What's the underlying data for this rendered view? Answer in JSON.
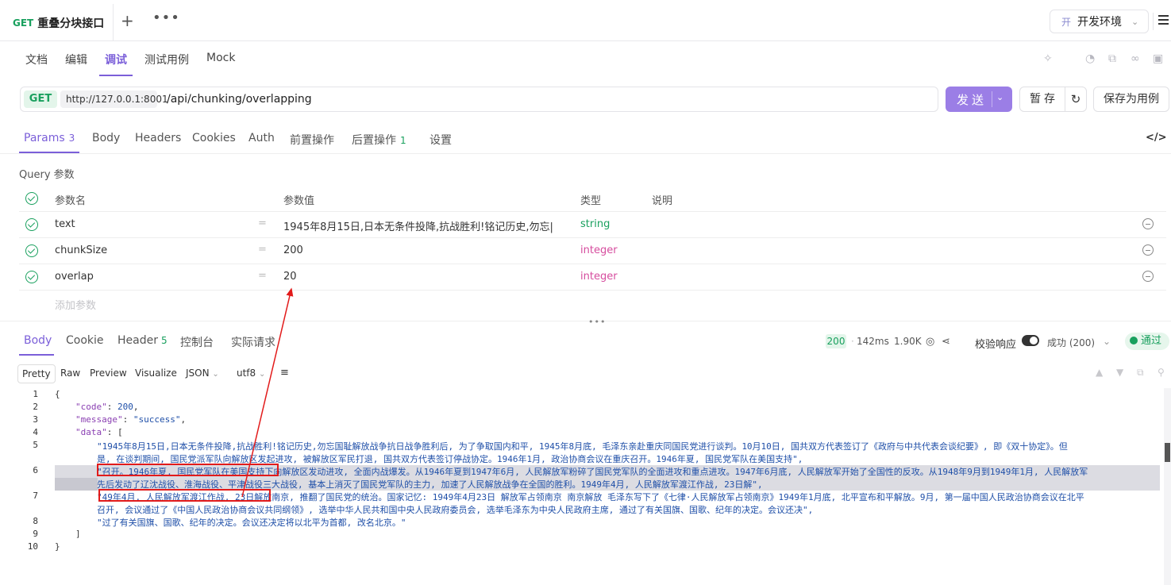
{
  "top_tab": {
    "method": "GET",
    "title": "重叠分块接口",
    "plus": "+",
    "more": "•••"
  },
  "env": {
    "badge": "开",
    "name": "开发环境"
  },
  "sub_tabs": [
    "文档",
    "编辑",
    "调试",
    "测试用例",
    "Mock"
  ],
  "url": {
    "method": "GET",
    "host": "http://127.0.0.1:8001",
    "path": "/api/chunking/overlapping"
  },
  "actions": {
    "send": "发送",
    "save": "暂存",
    "save_as": "保存为用例"
  },
  "req_tabs": [
    {
      "label": "Params",
      "count": "3"
    },
    {
      "label": "Body",
      "count": ""
    },
    {
      "label": "Headers",
      "count": ""
    },
    {
      "label": "Cookies",
      "count": ""
    },
    {
      "label": "Auth",
      "count": ""
    },
    {
      "label": "前置操作",
      "count": ""
    },
    {
      "label": "后置操作",
      "count": "1"
    },
    {
      "label": "设置",
      "count": ""
    }
  ],
  "query": {
    "title": "Query 参数",
    "headers": {
      "name": "参数名",
      "value": "参数值",
      "type": "类型",
      "desc": "说明"
    },
    "rows": [
      {
        "name": "text",
        "value": "1945年8月15日,日本无条件投降,抗战胜利!铭记历史,勿忘|",
        "type": "string"
      },
      {
        "name": "chunkSize",
        "value": "200",
        "type": "integer"
      },
      {
        "name": "overlap",
        "value": "20",
        "type": "integer"
      }
    ],
    "add_placeholder": "添加参数"
  },
  "resp_tabs": [
    {
      "label": "Body",
      "count": ""
    },
    {
      "label": "Cookie",
      "count": ""
    },
    {
      "label": "Header",
      "count": "5"
    },
    {
      "label": "控制台",
      "count": ""
    },
    {
      "label": "实际请求",
      "count": ""
    }
  ],
  "resp_meta": {
    "status": "200",
    "time": "142ms",
    "size": "1.90K",
    "validate": "校验响应",
    "result": "成功 (200)",
    "pass": "通过"
  },
  "format_bar": {
    "modes": [
      "Pretty",
      "Raw",
      "Preview",
      "Visualize"
    ],
    "format": "JSON",
    "encoding": "utf8"
  },
  "code_lines": [
    {
      "no": "1",
      "text": "{"
    },
    {
      "no": "2",
      "key": "\"code\"",
      "rest": ": ",
      "val": "200",
      "tail": ","
    },
    {
      "no": "3",
      "key": "\"message\"",
      "rest": ": ",
      "val": "\"success\"",
      "tail": ","
    },
    {
      "no": "4",
      "key": "\"data\"",
      "rest": ": [",
      "val": "",
      "tail": ""
    },
    {
      "no": "5",
      "a": "\"1945年8月15日,日本无条件投降,抗战胜利!铭记历史,勿忘国耻解放战争抗日战争胜利后, 为了争取国内和平, 1945年8月底, 毛泽东亲赴重庆同国民党进行谈判。10月10日, 国共双方代表签订了《政府与中共代表会谈纪要》, 即《双十协定》。但",
      "b": "是, 在谈判期间, 国民党派军队向解放区发起进攻, 被解放区军民打退, 国共双方代表签订停战协定。1946年1月, 政治协商会议在重庆召开。1946年夏, 国民党军队在美国支持\","
    },
    {
      "no": "6",
      "a": "\"召开。1946年夏, 国民党军队在美国支持下向解放区发动进攻, 全面内战爆发。从1946年夏到1947年6月, 人民解放军粉碎了国民党军队的全面进攻和重点进攻。1947年6月底, 人民解放军开始了全国性的反攻。从1948年9月到1949年1月, 人民解放军",
      "b": "先后发动了辽沈战役、淮海战役、平津战役三大战役, 基本上消灭了国民党军队的主力, 加速了人民解放战争在全国的胜利。1949年4月, 人民解放军渡江作战, 23日解\","
    },
    {
      "no": "7",
      "a": "\"49年4月, 人民解放军渡江作战, 23日解放南京, 推翻了国民党的统治。国家记忆: 1949年4月23日 解放军占领南京 南京解放 毛泽东写下了《七律·人民解放军占领南京》1949年1月底, 北平宣布和平解放。9月, 第一届中国人民政治协商会议在北平",
      "b": "召开, 会议通过了《中国人民政治协商会议共同纲领》, 选举中华人民共和国中央人民政府委员会, 选举毛泽东为中央人民政府主席, 通过了有关国旗、国歌、纪年的决定。会议还决\","
    },
    {
      "no": "8",
      "text": "\"过了有关国旗、国歌、纪年的决定。会议还决定将以北平为首都, 改名北京。\""
    },
    {
      "no": "9",
      "text": "]"
    },
    {
      "no": "10",
      "text": "}"
    }
  ]
}
